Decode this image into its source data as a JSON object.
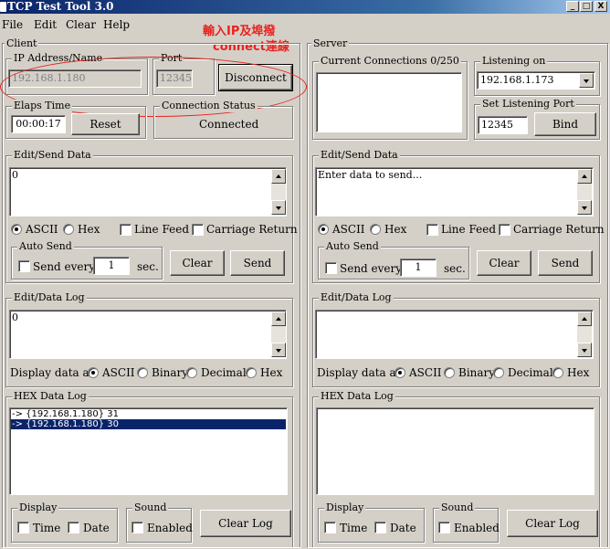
{
  "window": {
    "title": "TCP Test Tool 3.0",
    "min": "_",
    "max": "□",
    "close": "X"
  },
  "menu": [
    "File",
    "Edit",
    "Clear",
    "Help"
  ],
  "annotation": {
    "line1": "輸入IP及埠撥",
    "line2": "connect連線"
  },
  "client": {
    "title": "Client",
    "ip_label": "IP Address/Name",
    "ip_value": "192.168.1.180",
    "port_label": "Port",
    "port_value": "12345",
    "disconnect_label": "Disconnect",
    "elaps_label": "Elaps Time",
    "elaps_value": "00:00:17",
    "reset_label": "Reset",
    "status_label": "Connection Status",
    "status_value": "Connected",
    "send": {
      "title": "Edit/Send Data",
      "content": "0",
      "ascii": "ASCII",
      "hex": "Hex",
      "line_feed": "Line Feed",
      "carriage_return": "Carriage Return",
      "auto_send": "Auto Send",
      "send_every": "Send every",
      "interval": "1",
      "sec": "sec.",
      "clear": "Clear",
      "send_btn": "Send"
    },
    "log": {
      "title": "Edit/Data Log",
      "content": "0",
      "display_as": "Display data as:",
      "ascii": "ASCII",
      "binary": "Binary",
      "decimal": "Decimal",
      "hex": "Hex"
    },
    "hexlog": {
      "title": "HEX Data Log",
      "lines": [
        "-> {192.168.1.180} 31",
        "-> {192.168.1.180} 30"
      ],
      "display": "Display",
      "time": "Time",
      "date": "Date",
      "sound": "Sound",
      "enabled": "Enabled",
      "clear_log": "Clear Log"
    }
  },
  "server": {
    "title": "Server",
    "connections_label": "Current Connections 0/250",
    "listening_label": "Listening on",
    "listening_value": "192.168.1.173",
    "set_port_label": "Set Listening Port",
    "port_value": "12345",
    "bind_label": "Bind",
    "send": {
      "title": "Edit/Send Data",
      "content": "Enter data to send...",
      "ascii": "ASCII",
      "hex": "Hex",
      "line_feed": "Line Feed",
      "carriage_return": "Carriage Return",
      "auto_send": "Auto Send",
      "send_every": "Send every",
      "interval": "1",
      "sec": "sec.",
      "clear": "Clear",
      "send_btn": "Send"
    },
    "log": {
      "title": "Edit/Data Log",
      "display_as": "Display data as:",
      "ascii": "ASCII",
      "binary": "Binary",
      "decimal": "Decimal",
      "hex": "Hex"
    },
    "hexlog": {
      "title": "HEX Data Log",
      "display": "Display",
      "time": "Time",
      "date": "Date",
      "sound": "Sound",
      "enabled": "Enabled",
      "clear_log": "Clear Log"
    }
  }
}
